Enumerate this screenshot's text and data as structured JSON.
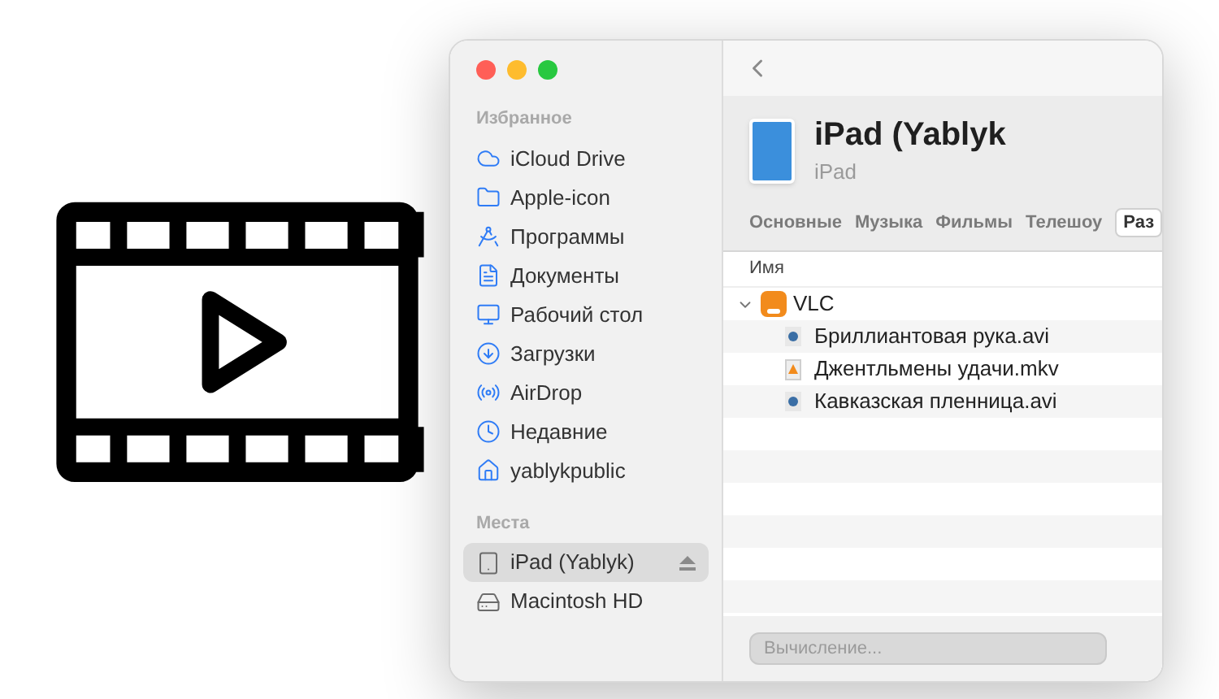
{
  "sidebar": {
    "sections": [
      {
        "title": "Избранное",
        "items": [
          {
            "label": "iCloud Drive",
            "kind": "cloud",
            "selected": false
          },
          {
            "label": "Apple-icon",
            "kind": "folder",
            "selected": false
          },
          {
            "label": "Программы",
            "kind": "apps",
            "selected": false
          },
          {
            "label": "Документы",
            "kind": "document",
            "selected": false
          },
          {
            "label": "Рабочий стол",
            "kind": "desktop",
            "selected": false
          },
          {
            "label": "Загрузки",
            "kind": "download",
            "selected": false
          },
          {
            "label": "AirDrop",
            "kind": "airdrop",
            "selected": false
          },
          {
            "label": "Недавние",
            "kind": "recent",
            "selected": false
          },
          {
            "label": "yablykpublic",
            "kind": "home",
            "selected": false
          }
        ]
      },
      {
        "title": "Места",
        "items": [
          {
            "label": "iPad (Yablyk)",
            "kind": "ipad",
            "selected": true,
            "ejectable": true
          },
          {
            "label": "Macintosh HD",
            "kind": "disk",
            "selected": false,
            "ejectable": false
          }
        ]
      }
    ]
  },
  "device": {
    "title": "iPad (Yablyk",
    "subtitle": "iPad"
  },
  "tabs": [
    {
      "label": "Основные",
      "selected": false
    },
    {
      "label": "Музыка",
      "selected": false
    },
    {
      "label": "Фильмы",
      "selected": false
    },
    {
      "label": "Телешоу",
      "selected": false
    },
    {
      "label": "Раз",
      "selected": true
    }
  ],
  "file_list": {
    "column": "Имя",
    "items": [
      {
        "name": "VLC",
        "kind": "app",
        "expanded": true,
        "children": [
          {
            "name": "Бриллиантовая рука.avi",
            "kind": "video"
          },
          {
            "name": "Джентльмены удачи.mkv",
            "kind": "vlc-file"
          },
          {
            "name": "Кавказская пленница.avi",
            "kind": "video"
          }
        ]
      }
    ]
  },
  "storage_bar": {
    "label": "Вычисление..."
  }
}
